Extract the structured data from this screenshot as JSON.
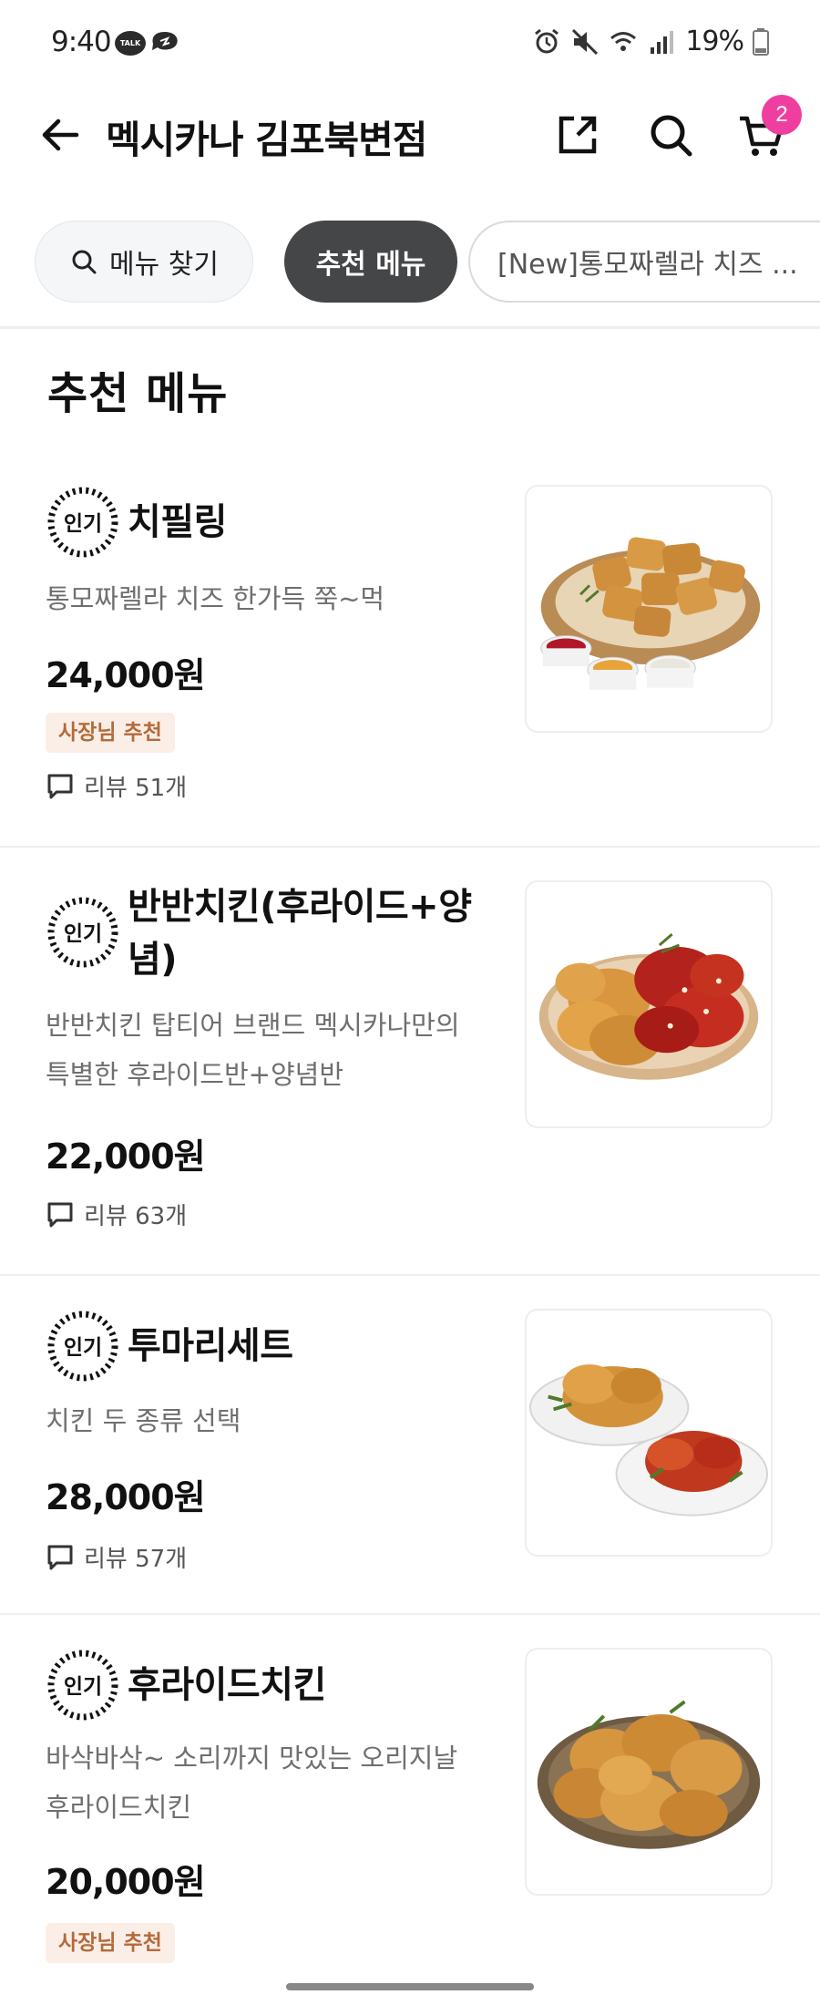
{
  "status_bar": {
    "time": "9:40",
    "talk_label": "TALK",
    "battery": "19%"
  },
  "header": {
    "title": "멕시카나 김포북변점",
    "cart_count": "2"
  },
  "chips": {
    "search": "메뉴 찾기",
    "recommended": "추천 메뉴",
    "new_item": "[New]통모짜렐라 치즈 ..."
  },
  "section": {
    "title": "추천 메뉴"
  },
  "badges": {
    "popular": "인기"
  },
  "items": [
    {
      "name_lines": [
        "치필링"
      ],
      "desc_lines": [
        "통모짜렐라 치즈 한가득 쭉~먹"
      ],
      "price": "24,000원",
      "owner_badge": "사장님 추천",
      "review": "리뷰 51개"
    },
    {
      "name_lines": [
        "반반치킨(후라이드+양",
        "념)"
      ],
      "desc_lines": [
        "반반치킨 탑티어 브랜드 멕시카나만의",
        "특별한 후라이드반+양념반"
      ],
      "price": "22,000원",
      "review": "리뷰 63개"
    },
    {
      "name_lines": [
        "투마리세트"
      ],
      "desc_lines": [
        "치킨 두 종류 선택"
      ],
      "price": "28,000원",
      "review": "리뷰 57개"
    },
    {
      "name_lines": [
        "후라이드치킨"
      ],
      "desc_lines": [
        "바삭바삭~ 소리까지 맛있는 오리지날",
        "후라이드치킨"
      ],
      "price": "20,000원",
      "owner_badge": "사장님 추천"
    }
  ],
  "colors": {
    "cart_badge": "#ee3fa0",
    "selected_chip": "#444648",
    "owner_badge_bg": "#fbeee6",
    "owner_badge_text": "#b46a3a"
  },
  "icons": [
    "back-arrow-icon",
    "share-icon",
    "search-icon",
    "cart-icon",
    "popular-icon",
    "review-icon"
  ]
}
